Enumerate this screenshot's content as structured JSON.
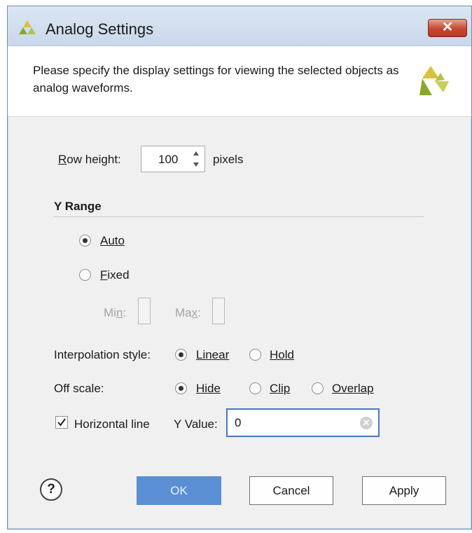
{
  "window": {
    "title": "Analog Settings",
    "close_glyph": "✕"
  },
  "header": {
    "description": "Please specify the display settings for viewing the selected objects as analog waveforms."
  },
  "row_height": {
    "label_accel": "R",
    "label_rest": "ow height:",
    "value": "100",
    "unit": "pixels"
  },
  "y_range": {
    "heading": "Y Range",
    "auto_label": "Auto",
    "fixed_label_accel": "F",
    "fixed_label_rest": "ixed",
    "selected": "Auto",
    "min_label_pre": "Mi",
    "min_label_accel": "n",
    "min_label_post": ":",
    "max_label_pre": "Ma",
    "max_label_accel": "x",
    "max_label_post": ":"
  },
  "interpolation": {
    "label": "Interpolation style:",
    "linear_label": "Linear",
    "hold_label": "Hold",
    "selected": "Linear"
  },
  "off_scale": {
    "label": "Off scale:",
    "hide_label": "Hide",
    "clip_label": "Clip",
    "overlap_label": "Overlap",
    "selected": "Hide"
  },
  "horizontal_line": {
    "label": "Horizontal line",
    "checked": true,
    "y_value_label": "Y Value:",
    "y_value": "0"
  },
  "buttons": {
    "help": "?",
    "ok": "OK",
    "cancel": "Cancel",
    "apply": "Apply"
  },
  "icons": {
    "title_logo": "vivado-logo-icon",
    "header_logo": "vivado-logo-icon",
    "close": "close-icon",
    "help": "help-icon",
    "clear": "clear-input-icon"
  },
  "colors": {
    "accent": "#4a78b8",
    "ok_button": "#5b8fd3",
    "close_button": "#c8452f",
    "logo_green": "#8aa82a",
    "logo_yellow": "#d9c23a"
  }
}
